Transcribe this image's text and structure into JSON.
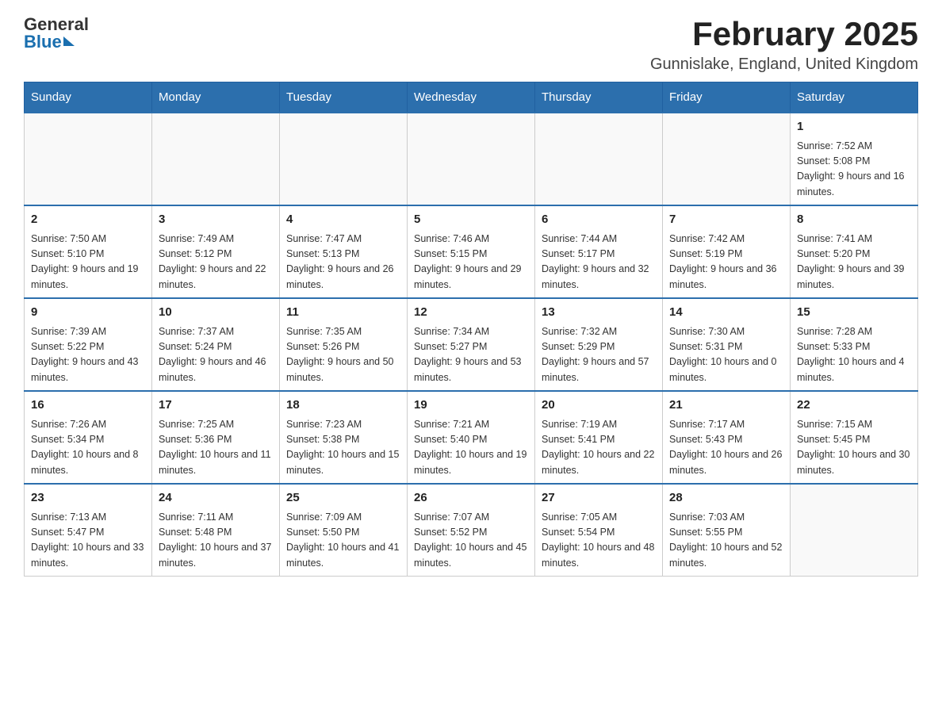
{
  "header": {
    "logo_general": "General",
    "logo_blue": "Blue",
    "title": "February 2025",
    "subtitle": "Gunnislake, England, United Kingdom"
  },
  "calendar": {
    "days_of_week": [
      "Sunday",
      "Monday",
      "Tuesday",
      "Wednesday",
      "Thursday",
      "Friday",
      "Saturday"
    ],
    "weeks": [
      [
        {
          "day": "",
          "info": ""
        },
        {
          "day": "",
          "info": ""
        },
        {
          "day": "",
          "info": ""
        },
        {
          "day": "",
          "info": ""
        },
        {
          "day": "",
          "info": ""
        },
        {
          "day": "",
          "info": ""
        },
        {
          "day": "1",
          "info": "Sunrise: 7:52 AM\nSunset: 5:08 PM\nDaylight: 9 hours and 16 minutes."
        }
      ],
      [
        {
          "day": "2",
          "info": "Sunrise: 7:50 AM\nSunset: 5:10 PM\nDaylight: 9 hours and 19 minutes."
        },
        {
          "day": "3",
          "info": "Sunrise: 7:49 AM\nSunset: 5:12 PM\nDaylight: 9 hours and 22 minutes."
        },
        {
          "day": "4",
          "info": "Sunrise: 7:47 AM\nSunset: 5:13 PM\nDaylight: 9 hours and 26 minutes."
        },
        {
          "day": "5",
          "info": "Sunrise: 7:46 AM\nSunset: 5:15 PM\nDaylight: 9 hours and 29 minutes."
        },
        {
          "day": "6",
          "info": "Sunrise: 7:44 AM\nSunset: 5:17 PM\nDaylight: 9 hours and 32 minutes."
        },
        {
          "day": "7",
          "info": "Sunrise: 7:42 AM\nSunset: 5:19 PM\nDaylight: 9 hours and 36 minutes."
        },
        {
          "day": "8",
          "info": "Sunrise: 7:41 AM\nSunset: 5:20 PM\nDaylight: 9 hours and 39 minutes."
        }
      ],
      [
        {
          "day": "9",
          "info": "Sunrise: 7:39 AM\nSunset: 5:22 PM\nDaylight: 9 hours and 43 minutes."
        },
        {
          "day": "10",
          "info": "Sunrise: 7:37 AM\nSunset: 5:24 PM\nDaylight: 9 hours and 46 minutes."
        },
        {
          "day": "11",
          "info": "Sunrise: 7:35 AM\nSunset: 5:26 PM\nDaylight: 9 hours and 50 minutes."
        },
        {
          "day": "12",
          "info": "Sunrise: 7:34 AM\nSunset: 5:27 PM\nDaylight: 9 hours and 53 minutes."
        },
        {
          "day": "13",
          "info": "Sunrise: 7:32 AM\nSunset: 5:29 PM\nDaylight: 9 hours and 57 minutes."
        },
        {
          "day": "14",
          "info": "Sunrise: 7:30 AM\nSunset: 5:31 PM\nDaylight: 10 hours and 0 minutes."
        },
        {
          "day": "15",
          "info": "Sunrise: 7:28 AM\nSunset: 5:33 PM\nDaylight: 10 hours and 4 minutes."
        }
      ],
      [
        {
          "day": "16",
          "info": "Sunrise: 7:26 AM\nSunset: 5:34 PM\nDaylight: 10 hours and 8 minutes."
        },
        {
          "day": "17",
          "info": "Sunrise: 7:25 AM\nSunset: 5:36 PM\nDaylight: 10 hours and 11 minutes."
        },
        {
          "day": "18",
          "info": "Sunrise: 7:23 AM\nSunset: 5:38 PM\nDaylight: 10 hours and 15 minutes."
        },
        {
          "day": "19",
          "info": "Sunrise: 7:21 AM\nSunset: 5:40 PM\nDaylight: 10 hours and 19 minutes."
        },
        {
          "day": "20",
          "info": "Sunrise: 7:19 AM\nSunset: 5:41 PM\nDaylight: 10 hours and 22 minutes."
        },
        {
          "day": "21",
          "info": "Sunrise: 7:17 AM\nSunset: 5:43 PM\nDaylight: 10 hours and 26 minutes."
        },
        {
          "day": "22",
          "info": "Sunrise: 7:15 AM\nSunset: 5:45 PM\nDaylight: 10 hours and 30 minutes."
        }
      ],
      [
        {
          "day": "23",
          "info": "Sunrise: 7:13 AM\nSunset: 5:47 PM\nDaylight: 10 hours and 33 minutes."
        },
        {
          "day": "24",
          "info": "Sunrise: 7:11 AM\nSunset: 5:48 PM\nDaylight: 10 hours and 37 minutes."
        },
        {
          "day": "25",
          "info": "Sunrise: 7:09 AM\nSunset: 5:50 PM\nDaylight: 10 hours and 41 minutes."
        },
        {
          "day": "26",
          "info": "Sunrise: 7:07 AM\nSunset: 5:52 PM\nDaylight: 10 hours and 45 minutes."
        },
        {
          "day": "27",
          "info": "Sunrise: 7:05 AM\nSunset: 5:54 PM\nDaylight: 10 hours and 48 minutes."
        },
        {
          "day": "28",
          "info": "Sunrise: 7:03 AM\nSunset: 5:55 PM\nDaylight: 10 hours and 52 minutes."
        },
        {
          "day": "",
          "info": ""
        }
      ]
    ]
  }
}
